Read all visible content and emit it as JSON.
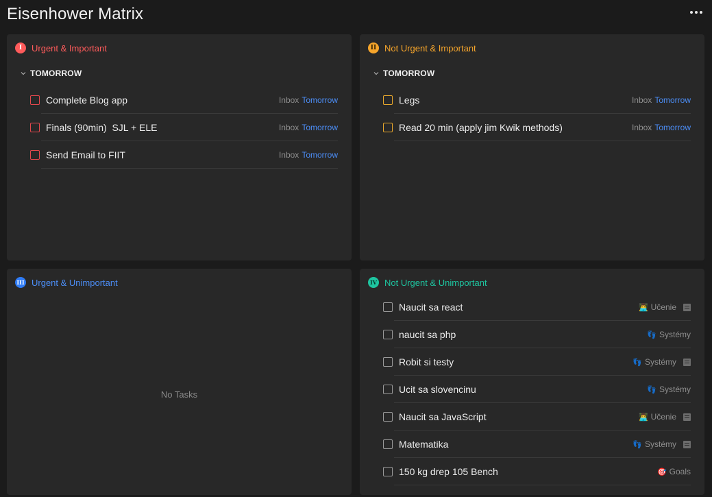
{
  "page": {
    "title": "Eisenhower Matrix",
    "more_icon": "more-horizontal-icon"
  },
  "quadrants": [
    {
      "badge": "I",
      "title": "Urgent & Important",
      "section": "TOMORROW",
      "color": "#ff5b5b",
      "tasks": [
        {
          "name": "Complete Blog app",
          "list": "Inbox",
          "date": "Tomorrow"
        },
        {
          "name": "Finals (90min)  SJL + ELE",
          "list": "Inbox",
          "date": "Tomorrow"
        },
        {
          "name": "Send Email to FIIT",
          "list": "Inbox",
          "date": "Tomorrow"
        }
      ]
    },
    {
      "badge": "II",
      "title": "Not Urgent & Important",
      "section": "TOMORROW",
      "color": "#f6a52b",
      "tasks": [
        {
          "name": "Legs",
          "list": "Inbox",
          "date": "Tomorrow"
        },
        {
          "name": "Read 20 min (apply jim Kwik methods)",
          "list": "Inbox",
          "date": "Tomorrow"
        }
      ]
    },
    {
      "badge": "III",
      "title": "Urgent & Unimportant",
      "color": "#2f7cf6",
      "empty": "No Tasks"
    },
    {
      "badge": "IV",
      "title": "Not Urgent & Unimportant",
      "color": "#1ec5a0",
      "tasks": [
        {
          "name": "Naucit sa react",
          "emoji": "👨‍💻",
          "list": "Učenie",
          "note": true
        },
        {
          "name": "naucit sa php",
          "emoji": "👣",
          "list": "Systémy",
          "note": false
        },
        {
          "name": "Robit si testy",
          "emoji": "👣",
          "list": "Systémy",
          "note": true
        },
        {
          "name": "Ucit sa slovencinu",
          "emoji": "👣",
          "list": "Systémy",
          "note": false
        },
        {
          "name": "Naucit sa JavaScript",
          "emoji": "👨‍💻",
          "list": "Učenie",
          "note": true
        },
        {
          "name": "Matematika",
          "emoji": "👣",
          "list": "Systémy",
          "note": true
        },
        {
          "name": "150 kg drep 105 Bench",
          "emoji": "🎯",
          "list": "Goals",
          "note": false
        }
      ]
    }
  ]
}
